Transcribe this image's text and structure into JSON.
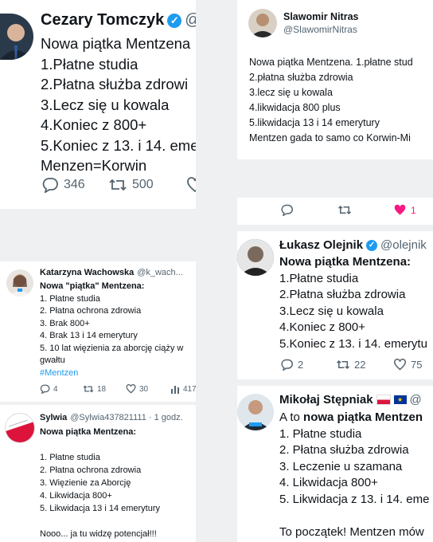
{
  "tweets": {
    "cezary": {
      "name": "Cezary Tomczyk",
      "handle": "@",
      "lines": [
        "Nowa piątka Mentzena",
        "1.Płatne studia",
        "2.Płatna służba zdrowi",
        "3.Lecz się u kowala",
        "4.Koniec z 800+",
        "5.Koniec z 13. i 14. eme",
        "Menzen=Korwin"
      ],
      "replies": "346",
      "retweets": "500"
    },
    "slawomir": {
      "name": "Slawomir Nitras",
      "handle": "@SlawomirNitras",
      "lines": [
        "Nowa piątka Mentzena. 1.płatne stud",
        "2.płatna służba zdrowia",
        "3.lecz się u kowala",
        "4.likwidacja 800 plus",
        "5.likwidacja 13 i 14 emerytury",
        "Mentzen gada to samo co Korwin-Mi"
      ],
      "likes": "1"
    },
    "katarzyna": {
      "name": "Katarzyna Wachowska",
      "handle": "@k_wach...",
      "title": "Nowa \"piątka\" Mentzena:",
      "lines": [
        "1. Płatne studia",
        "2. Płatna ochrona zdrowia",
        "3. Brak 800+",
        "4. Brak 13 i 14 emerytury",
        "5. 10 lat więzienia za aborcję ciąży w",
        "gwałtu"
      ],
      "hashtag": "#Mentzen",
      "replies": "4",
      "retweets": "18",
      "likes": "30",
      "views": "417"
    },
    "lukasz": {
      "name": "Łukasz Olejnik",
      "handle": "@olejnik",
      "title": "Nowa piątka Mentzena:",
      "lines": [
        "1.Płatne studia",
        "2.Płatna służba zdrowia",
        "3.Lecz się u kowala",
        "4.Koniec z 800+",
        "5.Koniec z 13. i 14. emerytu"
      ],
      "replies": "2",
      "retweets": "22",
      "likes": "75"
    },
    "sylwia": {
      "name": "Sylwia",
      "handle": "@Sylwia437821111 · 1 godz.",
      "title": "Nowa piątka Mentzena:",
      "lines": [
        "1. Płatne studia",
        "2. Płatna ochrona zdrowia",
        "3. Więzienie za Aborcję",
        "4. Likwidacja 800+",
        "5. Likwidacja 13 i 14 emerytury"
      ],
      "closing": "Nooo... ja tu widzę potencjał!!!"
    },
    "mikolaj": {
      "name": "Mikołaj Stępniak",
      "handle": "@",
      "intro": "A to ",
      "intro_bold": "nowa piątka Mentzen",
      "lines": [
        "1. Płatne studia",
        "2. Płatna służba zdrowia",
        "3. Leczenie u szamana",
        "4. Likwidacja 800+",
        "5. Likwidacja z 13. i 14. eme"
      ],
      "closing": "To początek! Mentzen mów"
    }
  },
  "icons": {
    "reply": "reply-icon",
    "retweet": "retweet-icon",
    "like": "heart-icon",
    "views": "views-icon",
    "verified": "verified-badge-icon"
  },
  "colors": {
    "accent": "#1d9bf0",
    "like_active": "#f91880",
    "text_secondary": "#536471"
  }
}
